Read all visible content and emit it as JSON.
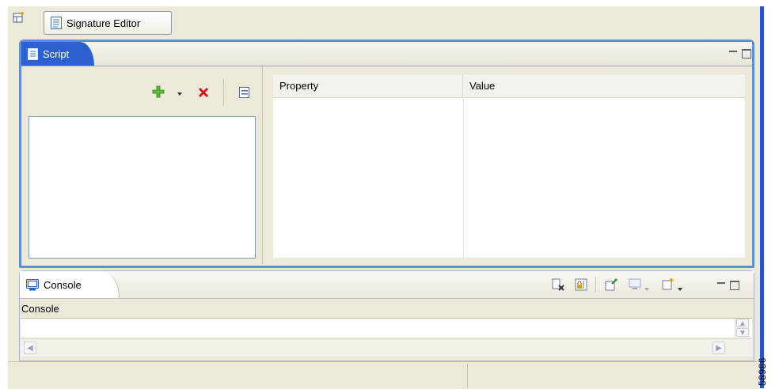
{
  "window": {
    "editor_button_label": "Signature Editor"
  },
  "script_view": {
    "tab_label": "Script",
    "table": {
      "columns": [
        "Property",
        "Value"
      ],
      "rows": []
    }
  },
  "console_view": {
    "tab_label": "Console",
    "content_label": "Console",
    "text": ""
  },
  "figure_number": "58986",
  "icons": {
    "perspective": "open-perspective-icon",
    "editor": "signature-editor-icon",
    "add": "add-plus-icon",
    "delete": "delete-x-icon",
    "collapse": "collapse-all-icon"
  },
  "colors": {
    "active_tab": "#2e61d0",
    "frame": "#5b8fd8",
    "add_icon": "#4caf2f",
    "delete_icon": "#d01818"
  }
}
